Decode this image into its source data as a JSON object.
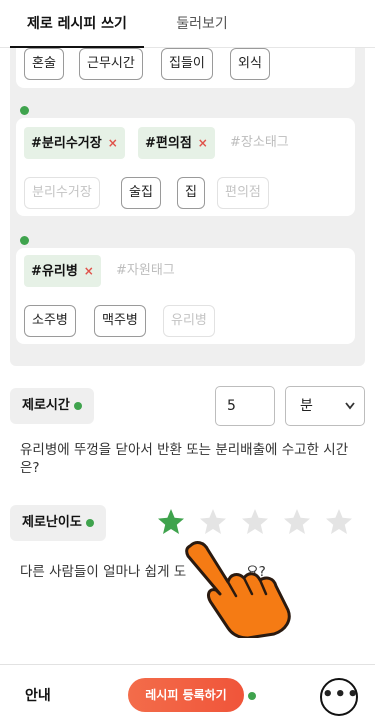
{
  "tabs": {
    "write": "제로 레시피 쓰기",
    "browse": "둘러보기"
  },
  "top_chips": [
    "혼술",
    "근무시간",
    "집들이",
    "외식"
  ],
  "place": {
    "tags": [
      "#분리수거장",
      "#편의점"
    ],
    "remove_symbol": "×",
    "placeholder": "#장소태그",
    "suggestions": [
      {
        "label": "분리수거장",
        "muted": true
      },
      {
        "label": "술집",
        "muted": false
      },
      {
        "label": "집",
        "muted": false
      },
      {
        "label": "편의점",
        "muted": true
      }
    ]
  },
  "resource": {
    "tags": [
      "#유리병"
    ],
    "placeholder": "#자원태그",
    "suggestions": [
      {
        "label": "소주병",
        "muted": false
      },
      {
        "label": "맥주병",
        "muted": false
      },
      {
        "label": "유리병",
        "muted": true
      }
    ]
  },
  "zero_time": {
    "label": "제로시간",
    "value": "5",
    "unit": "분",
    "question": "유리병에 뚜껑을 닫아서 반환 또는 분리배출에 수고한 시간은?"
  },
  "difficulty": {
    "label": "제로난이도",
    "rating": 1,
    "max": 5,
    "question": "다른 사람들이 얼마나 쉽게 도",
    "question_tail": "요?"
  },
  "bottom": {
    "guide": "안내",
    "register": "레시피 등록하기",
    "more": "•••"
  },
  "colors": {
    "accent_green": "#3fa34d",
    "tag_bg": "#e6f1e6",
    "register": "#f0553a",
    "remove_x": "#e0524a"
  }
}
